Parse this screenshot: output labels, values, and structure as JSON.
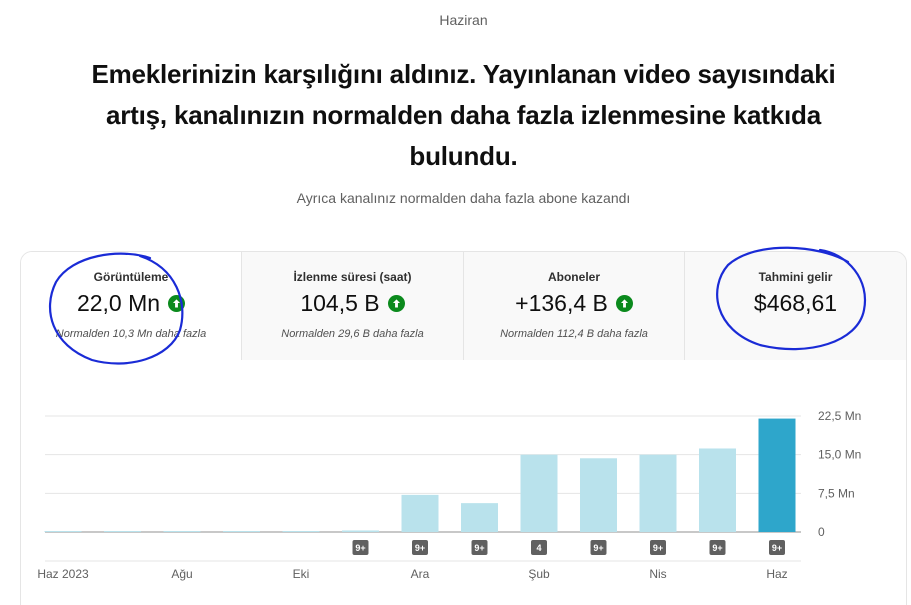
{
  "header": {
    "month": "Haziran",
    "headline": "Emeklerinizin karşılığını aldınız. Yayınlanan video sayısındaki artış, kanalınızın normalden daha fazla izlenmesine katkıda bulundu.",
    "subline": "Ayrıca kanalınız normalden daha fazla abone kazandı"
  },
  "metrics": [
    {
      "label": "Görüntüleme",
      "value": "22,0 Mn",
      "note": "Normalden 10,3 Mn daha fazla",
      "trend_icon": "arrow-up-circle-icon",
      "active": true
    },
    {
      "label": "İzlenme süresi (saat)",
      "value": "104,5 B",
      "note": "Normalden 29,6 B daha fazla",
      "trend_icon": "arrow-up-circle-icon",
      "active": false
    },
    {
      "label": "Aboneler",
      "value": "+136,4 B",
      "note": "Normalden 112,4 B daha fazla",
      "trend_icon": "arrow-up-circle-icon",
      "active": false
    },
    {
      "label": "Tahmini gelir",
      "value": "$468,61",
      "note": "",
      "trend_icon": "",
      "active": false
    }
  ],
  "colors": {
    "bar_light": "#b9e2ec",
    "bar_current": "#2ea6cb",
    "up_green": "#0b8a1d",
    "badge_bg": "#606060",
    "annotation_ink": "#1a2bd6"
  },
  "chart_data": {
    "type": "bar",
    "x": [
      "2023-06",
      "2023-07",
      "2023-08",
      "2023-09",
      "2023-10",
      "2023-11",
      "2023-12",
      "2024-01",
      "2024-02",
      "2024-03",
      "2024-04",
      "2024-05",
      "2024-06"
    ],
    "values": [
      0.05,
      0.05,
      0.05,
      0.05,
      0.05,
      0.3,
      7.2,
      5.6,
      15.0,
      14.3,
      15.0,
      16.2,
      22.0
    ],
    "badges": [
      "",
      "",
      "",
      "",
      "",
      "9+",
      "9+",
      "9+",
      "4",
      "9+",
      "9+",
      "9+",
      "9+"
    ],
    "x_tick_labels": [
      "Haz 2023",
      "Ağu",
      "Eki",
      "Ara",
      "Şub",
      "Nis",
      "Haz"
    ],
    "x_tick_months": [
      "2023-06",
      "2023-08",
      "2023-10",
      "2023-12",
      "2024-02",
      "2024-04",
      "2024-06"
    ],
    "y_tick_values": [
      0,
      7.5,
      15.0,
      22.5
    ],
    "y_tick_labels": [
      "0",
      "7,5 Mn",
      "15,0 Mn",
      "22,5 Mn"
    ],
    "ylim": [
      0,
      22.5
    ],
    "y_unit": "Mn",
    "highlight_last": true,
    "grid": true
  }
}
